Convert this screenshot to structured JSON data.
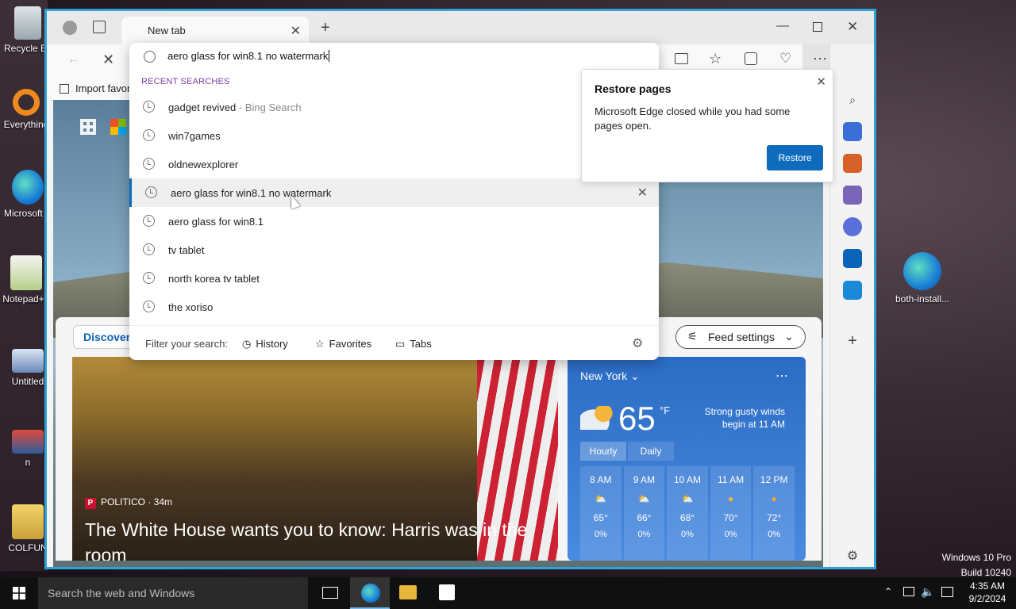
{
  "desktop": {
    "icons": [
      {
        "label": "Recycle Bin"
      },
      {
        "label": "Everything"
      },
      {
        "label": "Microsoft Edge"
      },
      {
        "label": "Notepad++"
      },
      {
        "label": "Untitled"
      },
      {
        "label": "n"
      },
      {
        "label": "COLFUN"
      }
    ],
    "right_icon": "both-install...",
    "watermark_line1": "Windows 10 Pro",
    "watermark_line2": "Build 10240"
  },
  "browser": {
    "tab_title": "New tab",
    "address_value": "aero glass for win8.1 no watermark",
    "fav_import": "Import favor",
    "dropdown": {
      "section_label": "RECENT SEARCHES",
      "items": [
        {
          "text": "gadget revived",
          "suffix": " - Bing Search"
        },
        {
          "text": "win7games",
          "suffix": ""
        },
        {
          "text": "oldnewexplorer",
          "suffix": ""
        },
        {
          "text": "aero glass for win8.1 no watermark",
          "suffix": ""
        },
        {
          "text": "aero glass for win8.1",
          "suffix": ""
        },
        {
          "text": "tv tablet",
          "suffix": ""
        },
        {
          "text": "north korea tv tablet",
          "suffix": ""
        },
        {
          "text": "the xoriso",
          "suffix": ""
        }
      ],
      "filter_label": "Filter your search:",
      "filter_history": "History",
      "filter_favorites": "Favorites",
      "filter_tabs": "Tabs"
    },
    "restore": {
      "title": "Restore pages",
      "message": "Microsoft Edge closed while you had some pages open.",
      "button": "Restore"
    },
    "feed": {
      "discover": "Discover",
      "feed_settings": "Feed settings",
      "news_source": "POLITICO · 34m",
      "news_headline": "The White House wants you to know: Harris was in the room"
    },
    "weather": {
      "city": "New York",
      "temp": "65",
      "unit": "°F",
      "desc": "Strong gusty winds begin at 11 AM",
      "tab_hourly": "Hourly",
      "tab_daily": "Daily",
      "hours": [
        {
          "t": "8 AM",
          "v": "65°",
          "p": "0%"
        },
        {
          "t": "9 AM",
          "v": "66°",
          "p": "0%"
        },
        {
          "t": "10 AM",
          "v": "68°",
          "p": "0%"
        },
        {
          "t": "11 AM",
          "v": "70°",
          "p": "0%"
        },
        {
          "t": "12 PM",
          "v": "72°",
          "p": "0%"
        }
      ]
    }
  },
  "taskbar": {
    "search_placeholder": "Search the web and Windows",
    "time": "4:35 AM",
    "date": "9/2/2024"
  }
}
